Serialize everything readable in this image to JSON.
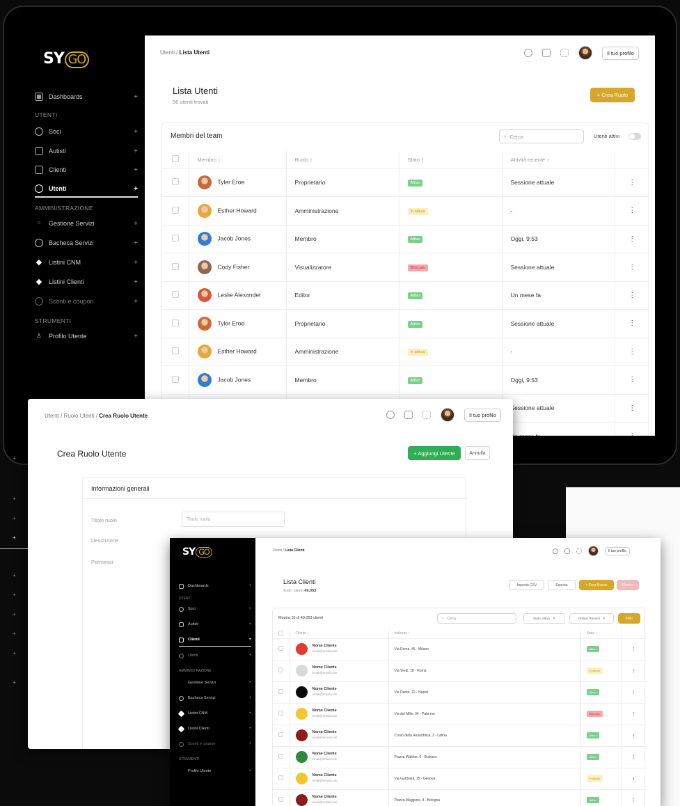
{
  "brand": {
    "logo_left": "SY",
    "logo_right": "GO"
  },
  "screen1": {
    "breadcrumb": {
      "parent": "Utenti",
      "current": "Lista Utenti"
    },
    "profile_label": "Il tuo profilo",
    "sidebar": {
      "dashboards": "Dashboards",
      "section_users": "UTENTI",
      "items_users": [
        "Soci",
        "Autisti",
        "Clienti",
        "Utenti"
      ],
      "section_admin": "AMMINISTRAZIONE",
      "items_admin": [
        "Gestione Servizi",
        "Bacheca Servizi",
        "Listini CNM",
        "Listini Clienti",
        "Sconti e coupon"
      ],
      "section_tools": "STRUMENTI",
      "items_tools": [
        "Profilo Utente"
      ],
      "plus": "+"
    },
    "title": "Lista Utenti",
    "subtitle": "56 utenti trovati",
    "create_button": "+ Crea Ruolo",
    "card_title": "Membri del team",
    "search_placeholder": "Cerca",
    "active_users_label": "Utenti attivi",
    "columns": [
      "Membro ↕",
      "Ruolo ↕",
      "Stato ↕",
      "Attività recente ↕"
    ],
    "rows": [
      {
        "name": "Tyler Eroe",
        "role": "Proprietario",
        "status": "Attivo",
        "status_kind": "g",
        "activity": "Sessione attuale",
        "face": "#c96a3a"
      },
      {
        "name": "Esther Howard",
        "role": "Amministrazione",
        "status": "In attesa",
        "status_kind": "y",
        "activity": "-",
        "face": "#e4a93a"
      },
      {
        "name": "Jacob Jones",
        "role": "Membro",
        "status": "Attivo",
        "status_kind": "g",
        "activity": "Oggi, 9:53",
        "face": "#2f7fd1"
      },
      {
        "name": "Cody Fisher",
        "role": "Visualizzatore",
        "status": "Bloccato",
        "status_kind": "r",
        "activity": "Sessione attuale",
        "face": "#8a6a55"
      },
      {
        "name": "Leslie Alexander",
        "role": "Editor",
        "status": "Attivo",
        "status_kind": "g",
        "activity": "Un mese fa",
        "face": "#d9573c"
      },
      {
        "name": "Tyler Eroe",
        "role": "Proprietario",
        "status": "Attivo",
        "status_kind": "g",
        "activity": "Sessione attuale",
        "face": "#c96a3a"
      },
      {
        "name": "Esther Howard",
        "role": "Amministrazione",
        "status": "In attesa",
        "status_kind": "y",
        "activity": "-",
        "face": "#e4a93a"
      },
      {
        "name": "Jacob Jones",
        "role": "Membro",
        "status": "Attivo",
        "status_kind": "g",
        "activity": "Oggi, 9:53",
        "face": "#2f7fd1"
      },
      {
        "name": "",
        "role": "",
        "status": "",
        "status_kind": "",
        "activity": "Sessione attuale",
        "face": "#8a6a55"
      },
      {
        "name": "",
        "role": "",
        "status": "",
        "status_kind": "",
        "activity": "Un mese fa",
        "face": "#d9573c"
      }
    ],
    "menu_glyph": "⋮"
  },
  "screen2": {
    "breadcrumb": {
      "a": "Utenti",
      "b": "Ruolo Utenti",
      "current": "Crea Ruolo Utente"
    },
    "profile_label": "Il tuo profilo",
    "title": "Crea Ruolo Utente",
    "add_button": "+ Aggiungi Utente",
    "cancel_button": "Annulla",
    "section_title": "Informazioni generali",
    "fields": [
      {
        "label": "Titolo ruolo",
        "placeholder": "Titolo ruolo"
      },
      {
        "label": "Descrizione",
        "placeholder": "Descrizione"
      },
      {
        "label": "Permessi",
        "placeholder": ""
      }
    ],
    "left_plus": "+"
  },
  "screen3": {
    "breadcrumb": {
      "parent": "Utenti",
      "current": "Lista Clienti"
    },
    "profile_label": "Il tuo profilo",
    "sidebar": {
      "dashboards": "Dashboards",
      "section_users": "UTENTI",
      "items_users": [
        "Soci",
        "Autisti",
        "Clienti",
        "Utenti"
      ],
      "section_admin": "AMMINISTRAZIONE",
      "items_admin": [
        "Gestione Servizi",
        "Bacheca Servizi",
        "Listini CNM",
        "Listini Clienti",
        "Sconti e coupon"
      ],
      "section_tools": "STRUMENTI",
      "items_tools": [
        "Profilo Utente"
      ]
    },
    "title": "Lista Clienti",
    "subtitle_prefix": "Tutti i clienti",
    "subtitle_count": "49,053",
    "buttons": {
      "import": "Importa CSV",
      "export": "Esporta",
      "add": "+ Crea Nuovo",
      "delete": "Elimina"
    },
    "showing": "Mostra 10 di 49,053 clienti",
    "search_placeholder": "Cerca",
    "filter1": "Stato: Attivo",
    "filter2": "Ordina: Recenti",
    "filter_button": "Filtri",
    "columns": [
      "Cliente ↕",
      "Indirizzo ↕",
      "Stato ↕"
    ],
    "client_name": "Nome Cliente",
    "client_email": "email@email.com",
    "rows": [
      {
        "color": "#e33a2f",
        "address": "Via Roma, 45 - Milano",
        "status": "Attivo",
        "kind": "g"
      },
      {
        "color": "#d9d9d9",
        "address": "Via Verdi, 18 - Roma",
        "status": "In attesa",
        "kind": "y"
      },
      {
        "color": "#0a0a0a",
        "address": "Via Dante, 12 - Napoli",
        "status": "Attivo",
        "kind": "g"
      },
      {
        "color": "#f2c630",
        "address": "Via del Mille, 34 - Palermo",
        "status": "Bloccato",
        "kind": "r"
      },
      {
        "color": "#8b1c1c",
        "address": "Corso della Repubblica, 3 - Latina",
        "status": "Attivo",
        "kind": "g"
      },
      {
        "color": "#2e8a3a",
        "address": "Piazza Walther, 6 - Bolzano",
        "status": "Attivo",
        "kind": "g"
      },
      {
        "color": "#f2c630",
        "address": "Via Garibaldi, 15 - Genova",
        "status": "In attesa",
        "kind": "y"
      },
      {
        "color": "#8b1c1c",
        "address": "Piazza Maggiore, 8 - Bologna",
        "status": "Attivo",
        "kind": "g"
      }
    ]
  }
}
